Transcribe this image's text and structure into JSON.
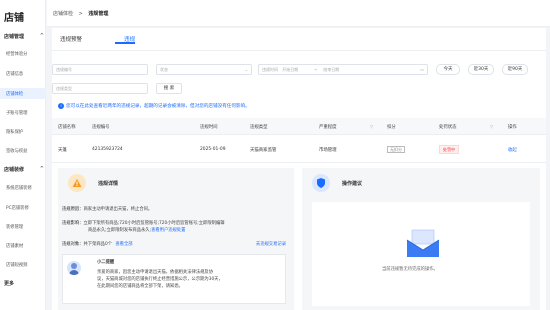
{
  "sidebar": {
    "title": "店铺",
    "sections": [
      {
        "label": "店铺管理",
        "items": [
          "经营体验分",
          "店铺信息",
          "店铺体检",
          "子账号管理",
          "隐私保护",
          "签收与权益"
        ]
      },
      {
        "label": "店铺装修",
        "items": [
          "系统店铺装修",
          "PC店铺装修",
          "装修管理",
          "店铺素材",
          "店铺短视频"
        ]
      },
      {
        "label": "更多",
        "items": []
      }
    ],
    "active_item": "店铺体检"
  },
  "breadcrumb": {
    "parent": "店铺体检",
    "sep": ">",
    "current": "违规管理"
  },
  "tabs": [
    "违规预警",
    "违规"
  ],
  "filters": {
    "violation_no": "违规编号",
    "status": "状态",
    "time_label": "违规时间",
    "start": "开始日期",
    "sep": "→",
    "end": "结束日期",
    "violation_type": "违规类型",
    "quick": [
      "今天",
      "近30天",
      "近90天"
    ],
    "search": "搜 索"
  },
  "notice": "您可以在此处查看近两年的违规记录，超期的记录会被清除，但对您的店铺没有任何影响。",
  "table": {
    "headers": [
      "店铺名称",
      "违规编号",
      "违规时间",
      "违规类型",
      "严重程度",
      "扣分",
      "处罚状态",
      "操作"
    ],
    "rows": [
      {
        "shop": "天蓬",
        "no": "42135923724",
        "time": "2025-01-09",
        "type": "天猫商家监管",
        "severity": "市场管理",
        "points": "无扣分",
        "status": "处罚中",
        "action": "收起"
      }
    ]
  },
  "detail": {
    "title": "违规详情",
    "reason_label": "违规原因：",
    "reason": "商家主动申请退出天猫，终止合同。",
    "impact_label": "违规影响：",
    "impact_1": "立即下架所有商品;720小时后监管账号;720小时后监管账号;立即限制编辑",
    "impact_2": "商品永久;立即限制发布商品永久;",
    "impact_link": "查看用户违规处置",
    "object_label": "违规对象：",
    "object": "共下架商品0个",
    "object_link": "查看全部",
    "right_link": "去违规交易记录",
    "tip": {
      "title": "小二提醒",
      "lines": [
        "亲爱的商家，因您主动申请退出天猫，依据相关法律法规及协",
        "议，天猫商城对您的店铺执行终止经营措施公示，公示期为30天，",
        "在此期间您的店铺商品将全部下架，请知悉。"
      ]
    }
  },
  "suggestion": {
    "title": "操作建议",
    "empty": "当前违规暂无待完成的操作。"
  },
  "colors": {
    "accent": "#1a6cff",
    "danger": "#f5222d",
    "warning_bg": "#fde7c3"
  }
}
